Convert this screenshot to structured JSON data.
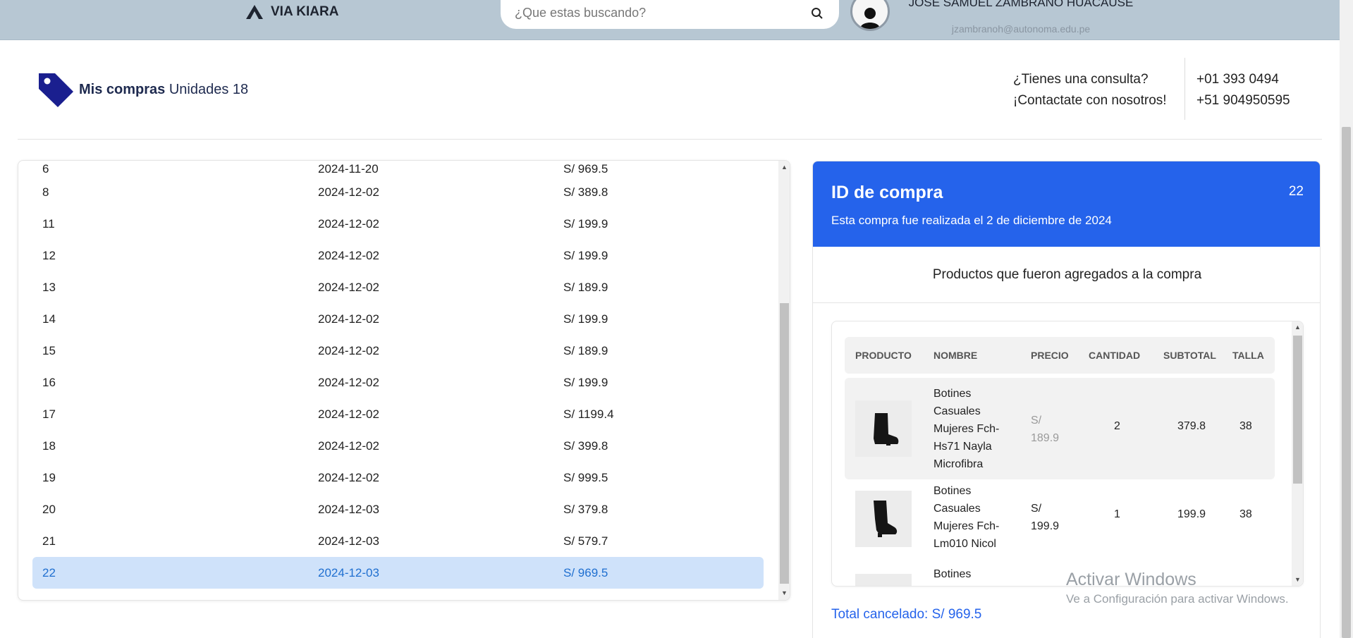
{
  "header": {
    "brand": "VIA KIARA",
    "search_placeholder": "¿Que estas buscando?",
    "user_name": "JOSE SAMUEL ZAMBRANO HUACAUSE",
    "user_email": "jzambranoh@autonoma.edu.pe"
  },
  "subheader": {
    "title": "Mis compras",
    "units": "Unidades 18",
    "question": "¿Tienes una consulta?",
    "contact": "¡Contactate con nosotros!",
    "phone1": "+01 393 0494",
    "phone2": "+51 904950595"
  },
  "purchases": {
    "partial_row": {
      "id": "6",
      "date": "2024-11-20",
      "total": "S/ 969.5"
    },
    "rows": [
      {
        "id": "8",
        "date": "2024-12-02",
        "total": "S/ 389.8"
      },
      {
        "id": "11",
        "date": "2024-12-02",
        "total": "S/ 199.9"
      },
      {
        "id": "12",
        "date": "2024-12-02",
        "total": "S/ 199.9"
      },
      {
        "id": "13",
        "date": "2024-12-02",
        "total": "S/ 189.9"
      },
      {
        "id": "14",
        "date": "2024-12-02",
        "total": "S/ 199.9"
      },
      {
        "id": "15",
        "date": "2024-12-02",
        "total": "S/ 189.9"
      },
      {
        "id": "16",
        "date": "2024-12-02",
        "total": "S/ 199.9"
      },
      {
        "id": "17",
        "date": "2024-12-02",
        "total": "S/ 1199.4"
      },
      {
        "id": "18",
        "date": "2024-12-02",
        "total": "S/ 399.8"
      },
      {
        "id": "19",
        "date": "2024-12-02",
        "total": "S/ 999.5"
      },
      {
        "id": "20",
        "date": "2024-12-03",
        "total": "S/ 379.8"
      },
      {
        "id": "21",
        "date": "2024-12-03",
        "total": "S/ 579.7"
      },
      {
        "id": "22",
        "date": "2024-12-03",
        "total": "S/ 969.5"
      }
    ],
    "selected_id": "22"
  },
  "detail": {
    "title": "ID de compra",
    "id": "22",
    "date_text": "Esta compra fue realizada el 2 de diciembre de 2024",
    "subtitle": "Productos que fueron agregados a la compra",
    "columns": [
      "PRODUCTO",
      "NOMBRE",
      "PRECIO",
      "CANTIDAD",
      "SUBTOTAL",
      "TALLA"
    ],
    "products": [
      {
        "name": "Botines Casuales Mujeres Fch-Hs71 Nayla Microfibra",
        "price": "S/ 189.9",
        "qty": "2",
        "subtotal": "379.8",
        "size": "38"
      },
      {
        "name": "Botines Casuales Mujeres Fch-Lm010 Nicol",
        "price": "S/ 199.9",
        "qty": "1",
        "subtotal": "199.9",
        "size": "38"
      },
      {
        "name": "Botines",
        "price": "",
        "qty": "",
        "subtotal": "",
        "size": ""
      }
    ],
    "total": "Total cancelado: S/ 969.5"
  },
  "watermark": {
    "line1": "Activar Windows",
    "line2": "Ve a Configuración para activar Windows."
  },
  "colors": {
    "header_bg": "#b7c7d3",
    "accent": "#2563eb",
    "selected_row_bg": "#cfe2fa",
    "brand_dark": "#1e2a4f"
  }
}
